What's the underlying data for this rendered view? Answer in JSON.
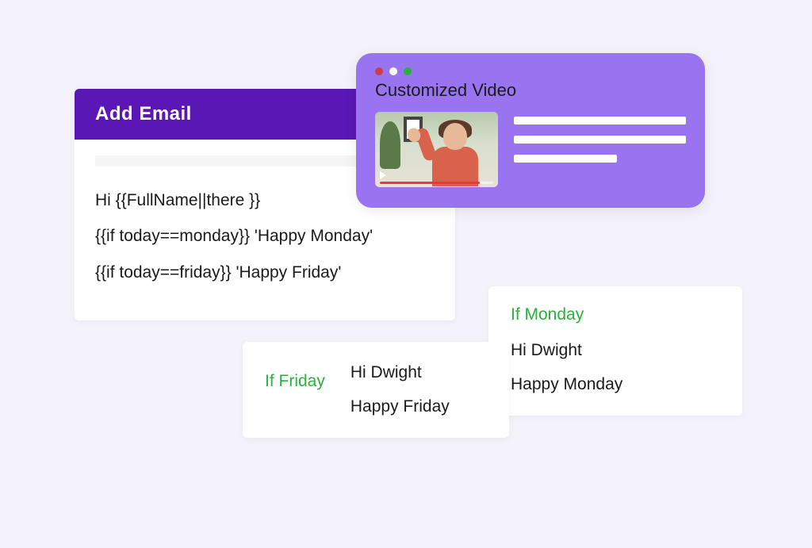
{
  "emailCard": {
    "title": "Add Email",
    "lines": [
      "Hi {{FullName||there }}",
      "{{if today==monday}} 'Happy Monday'",
      "{{if today==friday}} 'Happy Friday'"
    ]
  },
  "videoCard": {
    "title": "Customized Video"
  },
  "resultMonday": {
    "condition": "If Monday",
    "greeting": "Hi Dwight",
    "message": "Happy Monday"
  },
  "resultFriday": {
    "condition": "If Friday",
    "greeting": "Hi Dwight",
    "message": "Happy Friday"
  }
}
